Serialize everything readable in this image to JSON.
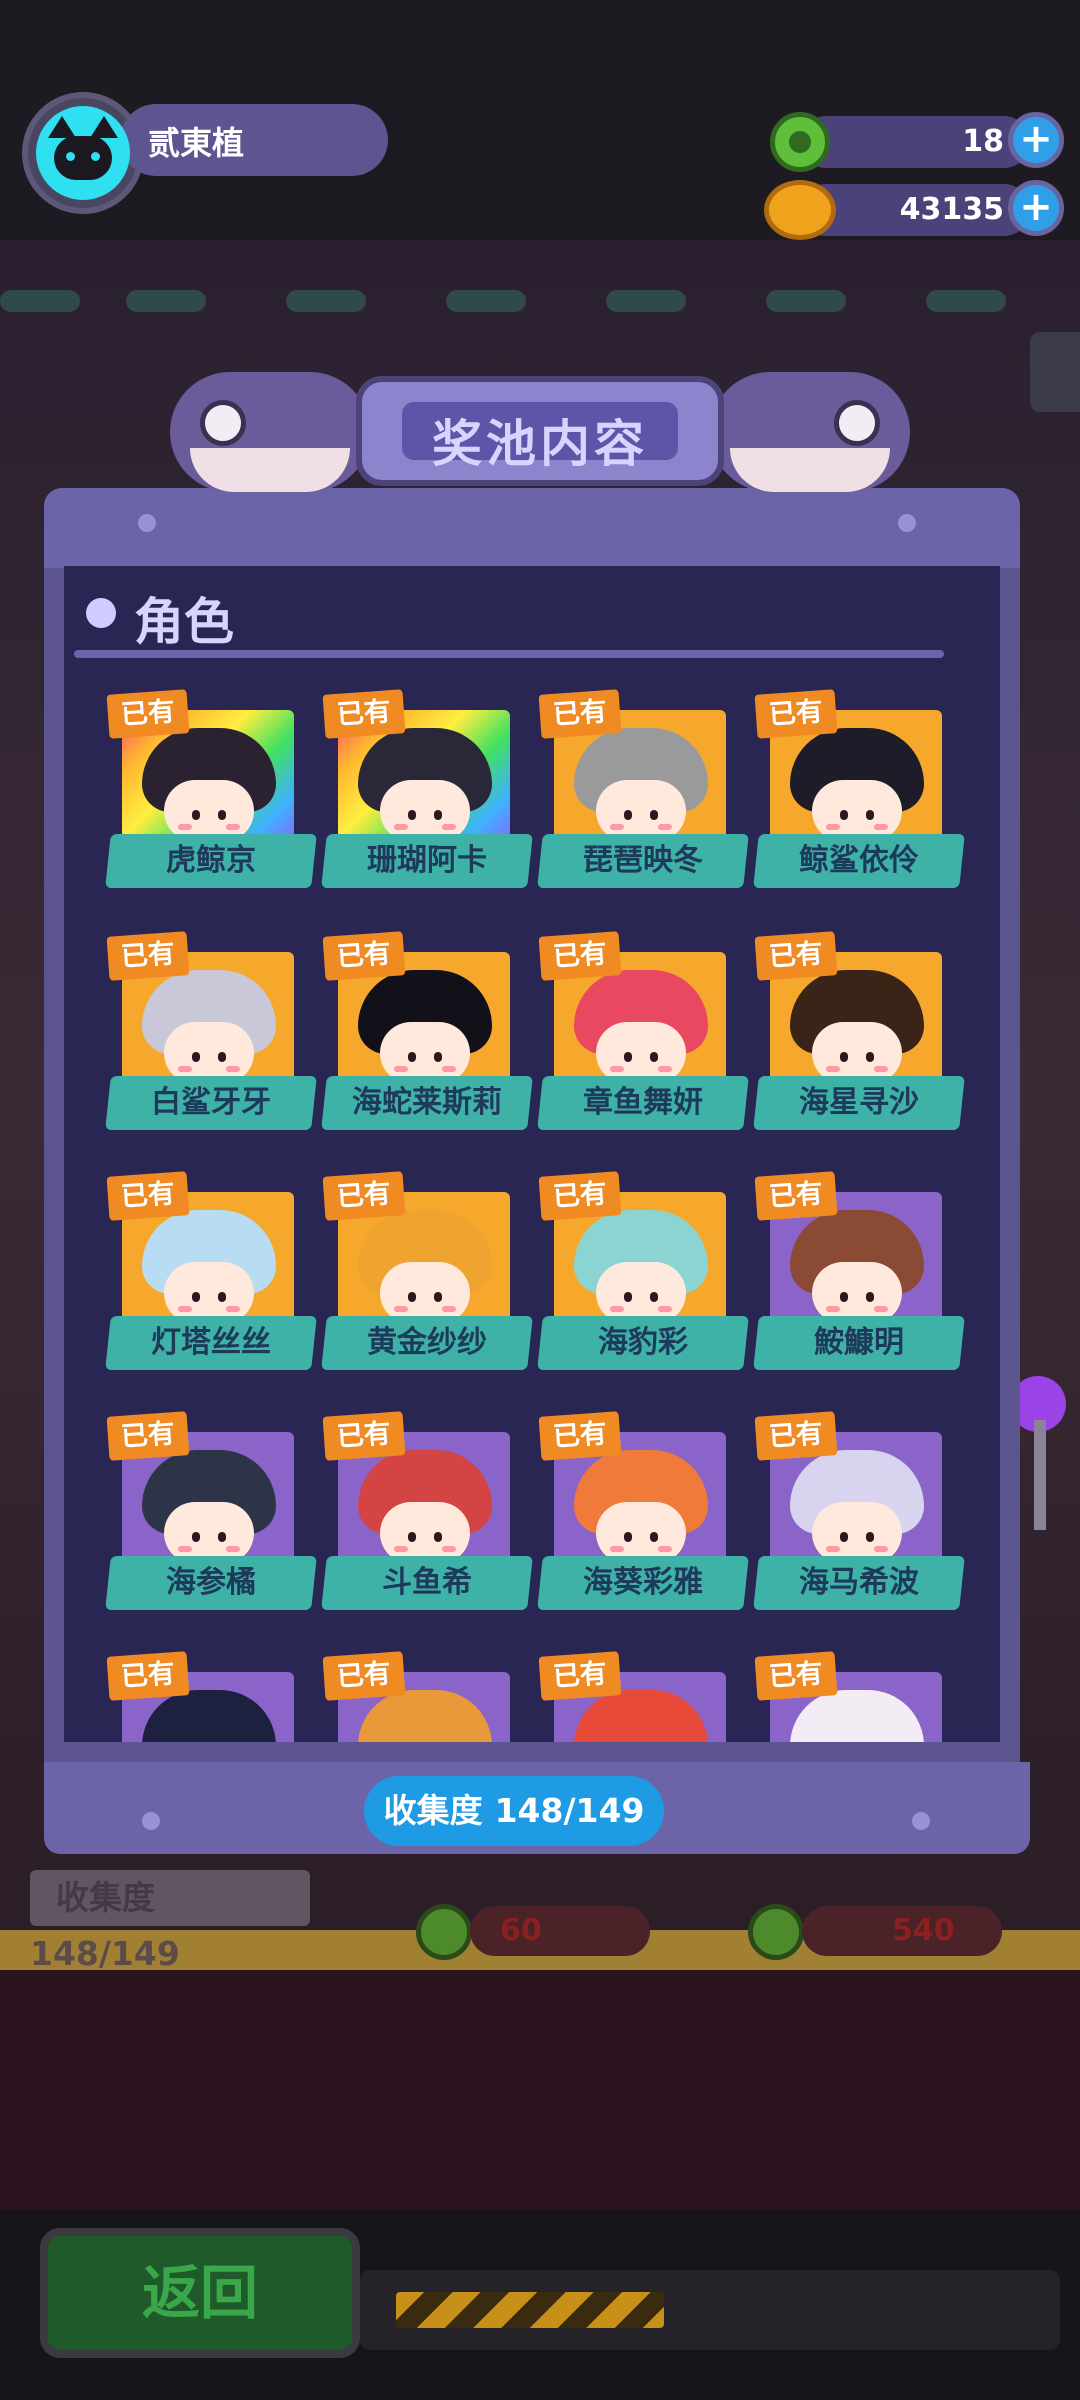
{
  "player": {
    "name": "贰東植"
  },
  "currency": {
    "gems": "18",
    "coins": "43135"
  },
  "panel": {
    "title": "奖池内容",
    "section_title": "角色",
    "owned_label": "已有",
    "collection_label": "收集度",
    "collection_value": "148/149"
  },
  "characters": [
    {
      "name": "虎鲸京",
      "bg": "rainbow",
      "hair": "#2a2230"
    },
    {
      "name": "珊瑚阿卡",
      "bg": "rainbow",
      "hair": "#2a2838"
    },
    {
      "name": "琵琶映冬",
      "bg": "gold",
      "hair": "#9a9a9c"
    },
    {
      "name": "鲸鲨依伶",
      "bg": "gold",
      "hair": "#1e1c28"
    },
    {
      "name": "白鲨牙牙",
      "bg": "gold",
      "hair": "#c8c8d8"
    },
    {
      "name": "海蛇莱斯莉",
      "bg": "gold",
      "hair": "#121018"
    },
    {
      "name": "章鱼舞妍",
      "bg": "gold",
      "hair": "#e84860"
    },
    {
      "name": "海星寻沙",
      "bg": "gold",
      "hair": "#3a2418"
    },
    {
      "name": "灯塔丝丝",
      "bg": "gold",
      "hair": "#b8dcf2"
    },
    {
      "name": "黄金纱纱",
      "bg": "gold",
      "hair": "#f0a430"
    },
    {
      "name": "海豹彩",
      "bg": "gold",
      "hair": "#8cd4d2"
    },
    {
      "name": "鮟鱇明",
      "bg": "purple",
      "hair": "#8a4a34"
    },
    {
      "name": "海参橘",
      "bg": "purple",
      "hair": "#2e3448"
    },
    {
      "name": "斗鱼希",
      "bg": "purple",
      "hair": "#d44444"
    },
    {
      "name": "海葵彩雅",
      "bg": "purple",
      "hair": "#f07a3a"
    },
    {
      "name": "海马希波",
      "bg": "purple",
      "hair": "#d8d4f0"
    },
    {
      "name": "",
      "bg": "purple",
      "hair": "#1e2040"
    },
    {
      "name": "",
      "bg": "purple",
      "hair": "#e89a3a"
    },
    {
      "name": "",
      "bg": "purple",
      "hair": "#e84a3a"
    },
    {
      "name": "",
      "bg": "purple",
      "hair": "#f4ecf4"
    }
  ],
  "background": {
    "collection_label": "收集度",
    "collection_value": "148/149",
    "price_1": "60",
    "price_2": "540"
  },
  "buttons": {
    "back": "返回"
  },
  "colors": {
    "accent_blue": "#1f9be6",
    "owned_orange": "#f08a22",
    "ribbon_teal": "#3fb2a8",
    "panel_purple": "#2a2654"
  }
}
